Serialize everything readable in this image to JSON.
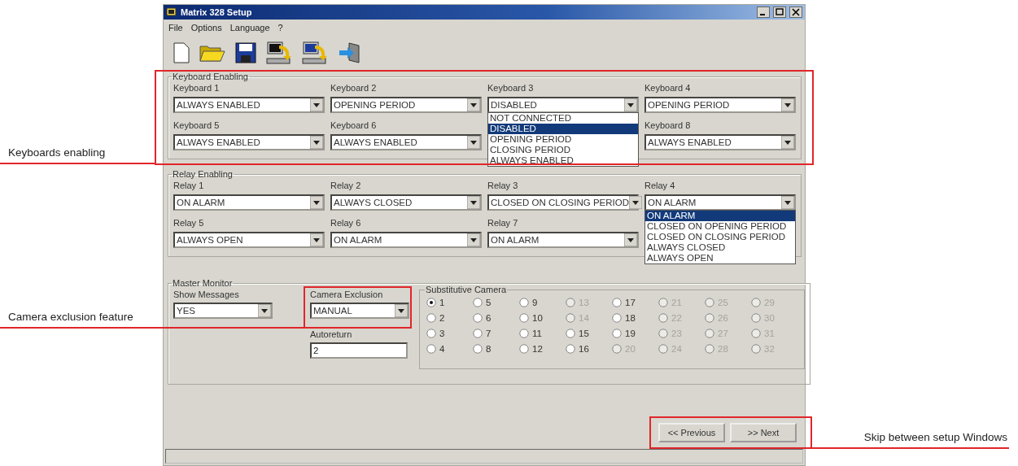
{
  "window": {
    "title": "Matrix 328 Setup"
  },
  "menu": [
    "File",
    "Options",
    "Language",
    "?"
  ],
  "keyboard_enabling": {
    "title": "Keyboard Enabling",
    "fields": [
      {
        "label": "Keyboard 1",
        "value": "ALWAYS ENABLED"
      },
      {
        "label": "Keyboard 2",
        "value": "OPENING PERIOD"
      },
      {
        "label": "Keyboard 3",
        "value": "DISABLED",
        "expanded": true,
        "options": [
          {
            "label": "NOT CONNECTED",
            "selected": false
          },
          {
            "label": "DISABLED",
            "selected": true
          },
          {
            "label": "OPENING PERIOD",
            "selected": false
          },
          {
            "label": "CLOSING PERIOD",
            "selected": false
          },
          {
            "label": "ALWAYS ENABLED",
            "selected": false
          }
        ]
      },
      {
        "label": "Keyboard 4",
        "value": "OPENING PERIOD"
      },
      {
        "label": "Keyboard 5",
        "value": "ALWAYS ENABLED"
      },
      {
        "label": "Keyboard 6",
        "value": "ALWAYS ENABLED"
      },
      {
        "label": "Keyboard 8",
        "value": "ALWAYS ENABLED"
      }
    ]
  },
  "relay_enabling": {
    "title": "Relay Enabling",
    "fields": [
      {
        "label": "Relay 1",
        "value": "ON ALARM"
      },
      {
        "label": "Relay 2",
        "value": "ALWAYS CLOSED"
      },
      {
        "label": "Relay 3",
        "value": "CLOSED ON CLOSING PERIOD"
      },
      {
        "label": "Relay 4",
        "value": "ON ALARM",
        "expanded": true,
        "options": [
          {
            "label": "ON ALARM",
            "selected": true
          },
          {
            "label": "CLOSED ON OPENING PERIOD",
            "selected": false
          },
          {
            "label": "CLOSED ON CLOSING PERIOD",
            "selected": false
          },
          {
            "label": "ALWAYS CLOSED",
            "selected": false
          },
          {
            "label": "ALWAYS OPEN",
            "selected": false
          }
        ]
      },
      {
        "label": "Relay 5",
        "value": "ALWAYS OPEN"
      },
      {
        "label": "Relay 6",
        "value": "ON ALARM"
      },
      {
        "label": "Relay 7",
        "value": "ON ALARM"
      }
    ]
  },
  "master_monitor": {
    "title": "Master Monitor",
    "show_messages": {
      "label": "Show Messages",
      "value": "YES"
    },
    "camera_exclusion": {
      "label": "Camera Exclusion",
      "value": "MANUAL"
    },
    "autoreturn": {
      "label": "Autoreturn",
      "value": "2"
    },
    "substitutive_camera": {
      "title": "Substitutive Camera",
      "options": [
        {
          "label": "1",
          "selected": true,
          "disabled": false
        },
        {
          "label": "2",
          "selected": false,
          "disabled": false
        },
        {
          "label": "3",
          "selected": false,
          "disabled": false
        },
        {
          "label": "4",
          "selected": false,
          "disabled": false
        },
        {
          "label": "5",
          "selected": false,
          "disabled": false
        },
        {
          "label": "6",
          "selected": false,
          "disabled": false
        },
        {
          "label": "7",
          "selected": false,
          "disabled": false
        },
        {
          "label": "8",
          "selected": false,
          "disabled": false
        },
        {
          "label": "9",
          "selected": false,
          "disabled": false
        },
        {
          "label": "10",
          "selected": false,
          "disabled": false
        },
        {
          "label": "11",
          "selected": false,
          "disabled": false
        },
        {
          "label": "12",
          "selected": false,
          "disabled": false
        },
        {
          "label": "13",
          "selected": false,
          "disabled": true
        },
        {
          "label": "14",
          "selected": false,
          "disabled": true
        },
        {
          "label": "15",
          "selected": false,
          "disabled": false
        },
        {
          "label": "16",
          "selected": false,
          "disabled": false
        },
        {
          "label": "17",
          "selected": false,
          "disabled": false
        },
        {
          "label": "18",
          "selected": false,
          "disabled": false
        },
        {
          "label": "19",
          "selected": false,
          "disabled": false
        },
        {
          "label": "20",
          "selected": false,
          "disabled": true
        },
        {
          "label": "21",
          "selected": false,
          "disabled": true
        },
        {
          "label": "22",
          "selected": false,
          "disabled": true
        },
        {
          "label": "23",
          "selected": false,
          "disabled": true
        },
        {
          "label": "24",
          "selected": false,
          "disabled": true
        },
        {
          "label": "25",
          "selected": false,
          "disabled": true
        },
        {
          "label": "26",
          "selected": false,
          "disabled": true
        },
        {
          "label": "27",
          "selected": false,
          "disabled": true
        },
        {
          "label": "28",
          "selected": false,
          "disabled": true
        },
        {
          "label": "29",
          "selected": false,
          "disabled": true
        },
        {
          "label": "30",
          "selected": false,
          "disabled": true
        },
        {
          "label": "31",
          "selected": false,
          "disabled": true
        },
        {
          "label": "32",
          "selected": false,
          "disabled": true
        }
      ]
    }
  },
  "buttons": [
    "<< Previous",
    ">> Next"
  ],
  "callouts": {
    "keyboards": "Keyboards enabling",
    "camera_exclusion": "Camera exclusion feature",
    "navigation": "Skip between setup Windows"
  }
}
